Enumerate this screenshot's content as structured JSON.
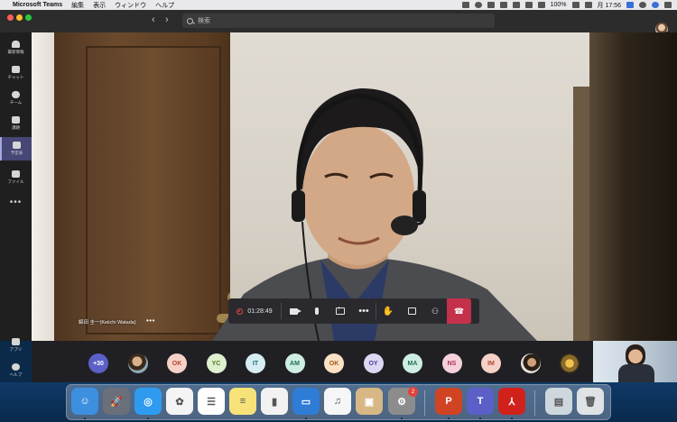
{
  "menubar": {
    "app_name": "Microsoft Teams",
    "menus": [
      "編集",
      "表示",
      "ウィンドウ",
      "ヘルプ"
    ],
    "battery": "100%",
    "clock": "月 17:56"
  },
  "titlebar": {
    "search_placeholder": "検索"
  },
  "rail": {
    "items": [
      {
        "label": "最新情報",
        "icon": "bell-icon"
      },
      {
        "label": "チャット",
        "icon": "chat-icon"
      },
      {
        "label": "チーム",
        "icon": "teams-icon"
      },
      {
        "label": "課題",
        "icon": "assignments-icon"
      },
      {
        "label": "予定表",
        "icon": "calendar-icon",
        "active": true
      },
      {
        "label": "ファイル",
        "icon": "files-icon"
      }
    ],
    "more": "•••",
    "apps_label": "アプリ",
    "help_label": "ヘルプ"
  },
  "stage": {
    "speaker_name": "綿田 圭一(Keiichi Watada)",
    "name_more": "•••"
  },
  "controls": {
    "timer": "01:28:49"
  },
  "participants": [
    {
      "initials": "+30",
      "bg": "#5b5fc7",
      "fg": "#ffffff"
    },
    {
      "initials": "",
      "photo": "photo1"
    },
    {
      "initials": "OK",
      "bg": "#f6d1c7",
      "fg": "#b3472f"
    },
    {
      "initials": "YC",
      "bg": "#dff0cf",
      "fg": "#4d7b24"
    },
    {
      "initials": "IT",
      "bg": "#d6eef2",
      "fg": "#1f6b7a"
    },
    {
      "initials": "AM",
      "bg": "#cfeee3",
      "fg": "#1d6e55"
    },
    {
      "initials": "OK",
      "bg": "#fbe2c4",
      "fg": "#a2581b"
    },
    {
      "initials": "OY",
      "bg": "#dcd8f3",
      "fg": "#4b3fa0"
    },
    {
      "initials": "MA",
      "bg": "#cfeee3",
      "fg": "#1d6e55"
    },
    {
      "initials": "NS",
      "bg": "#f6d1dc",
      "fg": "#a83256"
    },
    {
      "initials": "IM",
      "bg": "#f6d1c7",
      "fg": "#b3472f"
    },
    {
      "initials": "",
      "photo": "photo2"
    },
    {
      "initials": "",
      "photo": "photo3"
    }
  ],
  "dock": {
    "apps": [
      {
        "name": "finder-icon",
        "bg": "#3d8fe0",
        "glyph": "☺"
      },
      {
        "name": "launchpad-icon",
        "bg": "#6b6f7a",
        "glyph": "🚀"
      },
      {
        "name": "safari-icon",
        "bg": "#2e9bf0",
        "glyph": "◎"
      },
      {
        "name": "photos-icon",
        "bg": "#f4f4f4",
        "glyph": "✿"
      },
      {
        "name": "reminders-icon",
        "bg": "#ffffff",
        "glyph": "☰"
      },
      {
        "name": "notes-icon",
        "bg": "#f7e27a",
        "glyph": "≡"
      },
      {
        "name": "numbers-icon",
        "bg": "#f2f2f2",
        "glyph": "▮"
      },
      {
        "name": "keynote-icon",
        "bg": "#2f7cd6",
        "glyph": "▭"
      },
      {
        "name": "music-icon",
        "bg": "#f6f6f6",
        "glyph": "♫"
      },
      {
        "name": "preview-icon",
        "bg": "#d7b785",
        "glyph": "▣"
      },
      {
        "name": "system-preferences-icon",
        "bg": "#8c8c8c",
        "glyph": "⚙",
        "badge": "2"
      },
      {
        "name": "powerpoint-icon",
        "bg": "#d04423",
        "glyph": "P"
      },
      {
        "name": "teams-icon",
        "bg": "#5b5fc7",
        "glyph": "T"
      },
      {
        "name": "acrobat-icon",
        "bg": "#d0211b",
        "glyph": "⅄"
      },
      {
        "name": "downloads-folder-icon",
        "bg": "#cfd7de",
        "glyph": "▤"
      },
      {
        "name": "trash-icon",
        "bg": "#dfe3e6",
        "glyph": "🗑"
      }
    ]
  }
}
